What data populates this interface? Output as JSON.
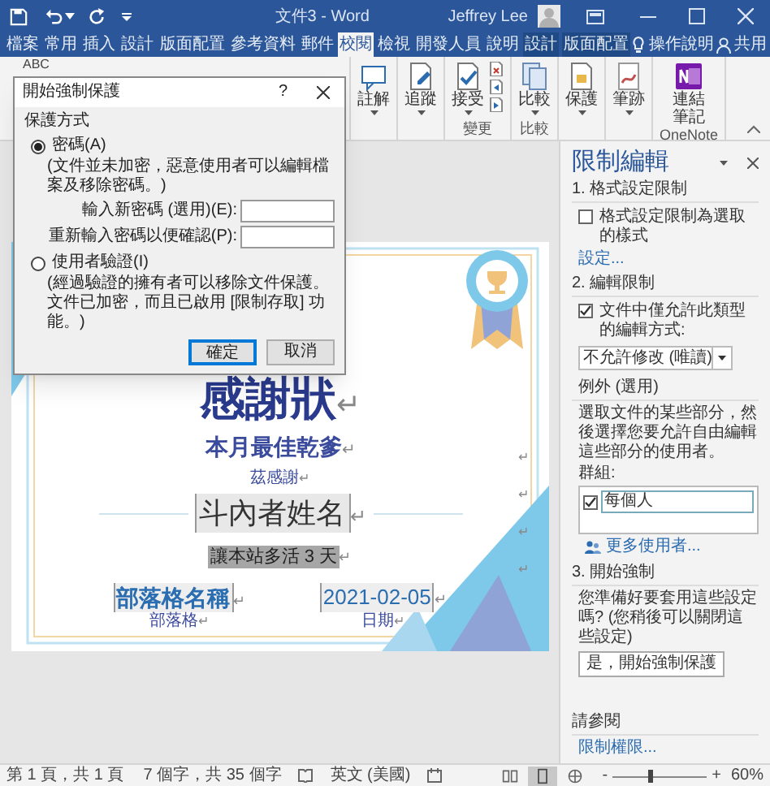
{
  "title_bar": {
    "title": "文件3 - Word",
    "user": "Jeffrey Lee"
  },
  "tabs": [
    {
      "label": "檔案",
      "selected": false,
      "kind": "normal"
    },
    {
      "label": "常用",
      "selected": false,
      "kind": "normal"
    },
    {
      "label": "插入",
      "selected": false,
      "kind": "normal"
    },
    {
      "label": "設計",
      "selected": false,
      "kind": "normal"
    },
    {
      "label": "版面配置",
      "selected": false,
      "kind": "normal"
    },
    {
      "label": "參考資料",
      "selected": false,
      "kind": "normal"
    },
    {
      "label": "郵件",
      "selected": false,
      "kind": "normal"
    },
    {
      "label": "校閱",
      "selected": true,
      "kind": "normal"
    },
    {
      "label": "檢視",
      "selected": false,
      "kind": "normal"
    },
    {
      "label": "開發人員",
      "selected": false,
      "kind": "normal"
    },
    {
      "label": "說明",
      "selected": false,
      "kind": "normal"
    },
    {
      "label": "設計",
      "selected": false,
      "kind": "context"
    },
    {
      "label": "版面配置",
      "selected": false,
      "kind": "context"
    }
  ],
  "tell_me": "操作說明",
  "share": "共用",
  "ribbon": {
    "partial_label": "ABC",
    "groups": [
      {
        "buttons": [
          {
            "label": "註解",
            "kind": "comment",
            "dropdown": true
          }
        ]
      },
      {
        "buttons": [
          {
            "label": "追蹤",
            "kind": "track",
            "dropdown": true
          }
        ]
      },
      {
        "label": "變更",
        "buttons": [
          {
            "label": "接受",
            "kind": "accept",
            "dropdown": true
          }
        ]
      },
      {
        "label": "比較",
        "buttons": [
          {
            "label": "比較",
            "kind": "compare",
            "dropdown": true
          }
        ]
      },
      {
        "buttons": [
          {
            "label": "保護",
            "kind": "protect",
            "dropdown": true
          }
        ]
      },
      {
        "buttons": [
          {
            "label": "筆跡",
            "kind": "ink",
            "dropdown": true
          }
        ]
      },
      {
        "label": "OneNote",
        "buttons": [
          {
            "label": "連結筆記",
            "kind": "onenote",
            "dropdown": false
          }
        ]
      }
    ]
  },
  "dialog": {
    "title": "開始強制保護",
    "help": "?",
    "section": "保護方式",
    "options": [
      {
        "label": "密碼(A)",
        "selected": true,
        "note": "(文件並未加密，惡意使用者可以編輯檔案及移除密碼。)"
      },
      {
        "label": "使用者驗證(I)",
        "selected": false,
        "note": "(經過驗證的擁有者可以移除文件保護。文件已加密，而且已啟用 [限制存取] 功能。)"
      }
    ],
    "fields": [
      {
        "label": "輸入新密碼 (選用)(E):"
      },
      {
        "label": "重新輸入密碼以便確認(P):"
      }
    ],
    "buttons": [
      {
        "label": "確定",
        "default": true
      },
      {
        "label": "取消",
        "default": false
      }
    ]
  },
  "certificate": {
    "title": {
      "text": "感謝狀",
      "mark": "↵"
    },
    "subtitle": {
      "text": "本月最佳乾爹",
      "mark": "↵"
    },
    "thanks": {
      "text": "茲感謝",
      "mark": "↵"
    },
    "name": {
      "text": "斗內者姓名",
      "mark": "↵"
    },
    "reason": {
      "text": "讓本站多活 3 天",
      "mark": "↵"
    },
    "blog": {
      "text": "部落格名稱",
      "mark": "↵"
    },
    "blog_label": {
      "text": "部落格",
      "mark": "↵"
    },
    "date": {
      "text": "2021-02-05",
      "mark": "↵"
    },
    "date_label": {
      "text": "日期",
      "mark": "↵"
    },
    "margin_marks": [
      "↵",
      "↵",
      "↵",
      "↵"
    ]
  },
  "pane": {
    "title": "限制編輯",
    "section_1": {
      "heading": "1. 格式設定限制",
      "checkbox": {
        "label": "格式設定限制為選取的樣式",
        "checked": false
      },
      "link": "設定..."
    },
    "section_2": {
      "heading": "2. 編輯限制",
      "checkbox": {
        "label": "文件中僅允許此類型的編輯方式:",
        "checked": true
      },
      "dropdown": "不允許修改 (唯讀)",
      "exceptions": "例外 (選用)",
      "description": "選取文件的某些部分，然後選擇您要允許自由編輯這些部分的使用者。",
      "groups_label": "群組:",
      "groups": [
        {
          "label": "每個人",
          "checked": true
        }
      ],
      "more_users": "更多使用者..."
    },
    "section_3": {
      "heading": "3. 開始強制",
      "question": "您準備好要套用這些設定嗎? (您稍後可以關閉這些設定)",
      "button": "是，開始強制保護"
    },
    "see_also": "請參閱",
    "permissions_link": "限制權限..."
  },
  "status_bar": {
    "page": "第 1 頁，共 1 頁",
    "words": "7 個字，共 35 個字",
    "language": "英文 (美國)",
    "views": [
      {
        "kind": "read",
        "selected": false
      },
      {
        "kind": "print",
        "selected": true
      },
      {
        "kind": "web",
        "selected": false
      }
    ],
    "zoom_minus": "-",
    "zoom_plus": "+",
    "zoom_slider": {
      "level": 0.4
    },
    "zoom": "60%"
  }
}
